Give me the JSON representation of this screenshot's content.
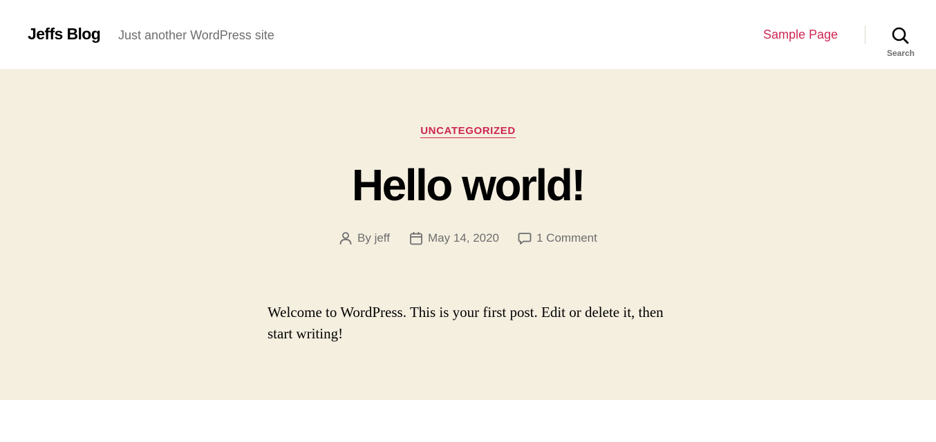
{
  "header": {
    "site_title": "Jeffs Blog",
    "tagline": "Just another WordPress site",
    "nav_link": "Sample Page",
    "search_label": "Search",
    "search_icon": "magnifying-glass"
  },
  "post": {
    "category": "UNCATEGORIZED",
    "title": "Hello world!",
    "meta": {
      "author_prefix": "By",
      "author": "jeff",
      "date": "May 14, 2020",
      "comments": "1 Comment",
      "author_icon": "person",
      "date_icon": "calendar",
      "comments_icon": "speech-bubble"
    },
    "body": "Welcome to WordPress. This is your first post. Edit or delete it, then start writing!"
  },
  "colors": {
    "accent": "#cd2653",
    "hero_background": "#f5efe0",
    "secondary_text": "#6d6d6d",
    "divider": "#dcd7ca"
  }
}
